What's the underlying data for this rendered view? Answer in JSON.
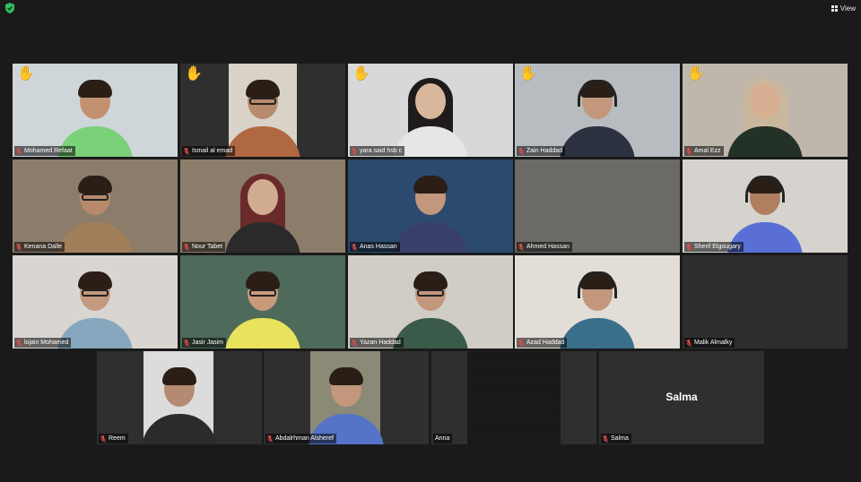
{
  "app": {
    "view_label": "View",
    "shield_icon": "shield-check-icon",
    "active_speaker_color": "#d7d34a"
  },
  "participants": [
    {
      "name": "Mohamed Refaat",
      "hand_raised": true,
      "muted": true,
      "bg": "#cfd6d9",
      "skin": "#c49170",
      "shirt": "#7bd07a",
      "style": "boy"
    },
    {
      "name": "Ismail al emad",
      "hand_raised": true,
      "muted": true,
      "bg": "#3b3b3b",
      "skin": "#b88b6d",
      "shirt": "#b06842",
      "style": "boy-glasses"
    },
    {
      "name": "yara said hsb c",
      "hand_raised": true,
      "muted": true,
      "bg": "#d8d8d8",
      "skin": "#d8b79c",
      "shirt": "#e6e6e6",
      "style": "hijab"
    },
    {
      "name": "Zain Haddad",
      "hand_raised": true,
      "muted": true,
      "bg": "#b8bcc0",
      "skin": "#c2977c",
      "shirt": "#2c3140",
      "style": "headset"
    },
    {
      "name": "Amal Ezz",
      "hand_raised": true,
      "muted": true,
      "bg": "#bfb7ac",
      "skin": "#d7b094",
      "shirt": "#243126",
      "style": "hijab-light"
    },
    {
      "name": "Kenana Dalle",
      "hand_raised": false,
      "muted": true,
      "bg": "#8c7d6a",
      "skin": "#b88a6b",
      "shirt": "#a27f5b",
      "style": "boy-glasses"
    },
    {
      "name": "Nour Tabet",
      "hand_raised": false,
      "muted": true,
      "bg": "#8c7d6a",
      "skin": "#d2ac90",
      "shirt": "#2a2a2a",
      "style": "hijab-maroon"
    },
    {
      "name": "Anas Hassan",
      "hand_raised": false,
      "muted": true,
      "bg": "#2c4a6e",
      "skin": "#c2977c",
      "shirt": "#3a3f6a",
      "style": "boy"
    },
    {
      "name": "Ahmed Hassan",
      "hand_raised": false,
      "muted": true,
      "bg": "#6b6a67",
      "skin": "#6b6a67",
      "shirt": "#6b6a67",
      "style": "blur"
    },
    {
      "name": "Sherif Elgougary",
      "hand_raised": false,
      "muted": true,
      "bg": "#d6d3cf",
      "skin": "#b07f5f",
      "shirt": "#5a6fd6",
      "style": "headset"
    },
    {
      "name": "lojain Mohamed",
      "hand_raised": false,
      "muted": true,
      "bg": "#d9d6d2",
      "skin": "#c39a7e",
      "shirt": "#86a7bd",
      "style": "girl-glasses"
    },
    {
      "name": "Jasir Jasim",
      "hand_raised": false,
      "muted": true,
      "bg": "#4d6a5a",
      "skin": "#c89a7a",
      "shirt": "#e8e25c",
      "style": "boy-glasses"
    },
    {
      "name": "Yazan Haddad",
      "hand_raised": false,
      "muted": true,
      "bg": "#cfcdc6",
      "skin": "#c2977c",
      "shirt": "#3a5a4a",
      "style": "boy-glasses"
    },
    {
      "name": "Azad Haddad",
      "hand_raised": false,
      "muted": true,
      "bg": "#e2ddd6",
      "skin": "#c2977c",
      "shirt": "#3a6f8a",
      "style": "headset"
    },
    {
      "name": "Malik Almalky",
      "hand_raised": false,
      "muted": true,
      "bg": "#2e2e2e",
      "skin": "#2e2e2e",
      "shirt": "#2e2e2e",
      "style": "dark"
    },
    {
      "name": "Reem",
      "hand_raised": false,
      "muted": true,
      "bg": "#dcdcdc",
      "skin": "#b48a72",
      "shirt": "#2b2b2b",
      "style": "girl-partial"
    },
    {
      "name": "Abdalrhman Alsheref",
      "hand_raised": false,
      "muted": true,
      "bg": "#8b8a77",
      "skin": "#c2977c",
      "shirt": "#5573c8",
      "style": "boy"
    },
    {
      "name": "Anna",
      "hand_raised": false,
      "muted": false,
      "bg": "#1e1e1e",
      "skin": "#1e1e1e",
      "shirt": "#1e1e1e",
      "style": "dark-noise"
    },
    {
      "name": "Salma",
      "hand_raised": false,
      "muted": true,
      "bg": "#2f2f2f",
      "skin": "#2f2f2f",
      "shirt": "#2f2f2f",
      "style": "name-only",
      "display_name": "Salma"
    }
  ]
}
